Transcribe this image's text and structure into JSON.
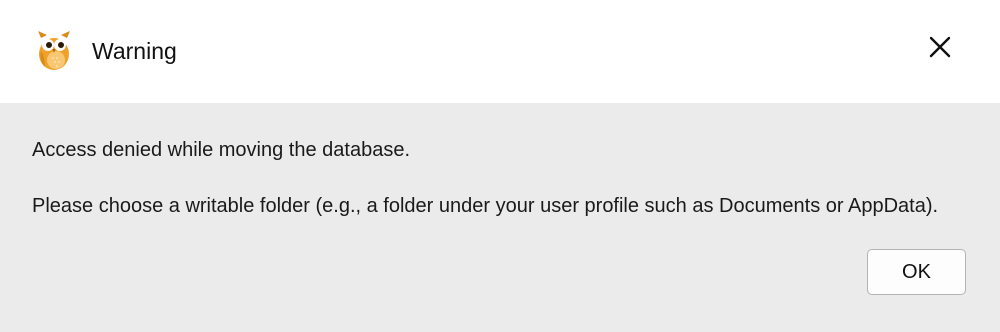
{
  "window": {
    "title": "Warning",
    "app_icon": "owl-icon",
    "close_icon": "close-icon"
  },
  "message": {
    "line1": "Access denied while moving the database.",
    "line2": "Please choose a writable folder (e.g., a folder under your user profile such as Documents or AppData)."
  },
  "buttons": {
    "ok_label": "OK"
  },
  "colors": {
    "titlebar_bg": "#ffffff",
    "body_bg": "#ebebeb",
    "owl_orange": "#f0a12a"
  }
}
